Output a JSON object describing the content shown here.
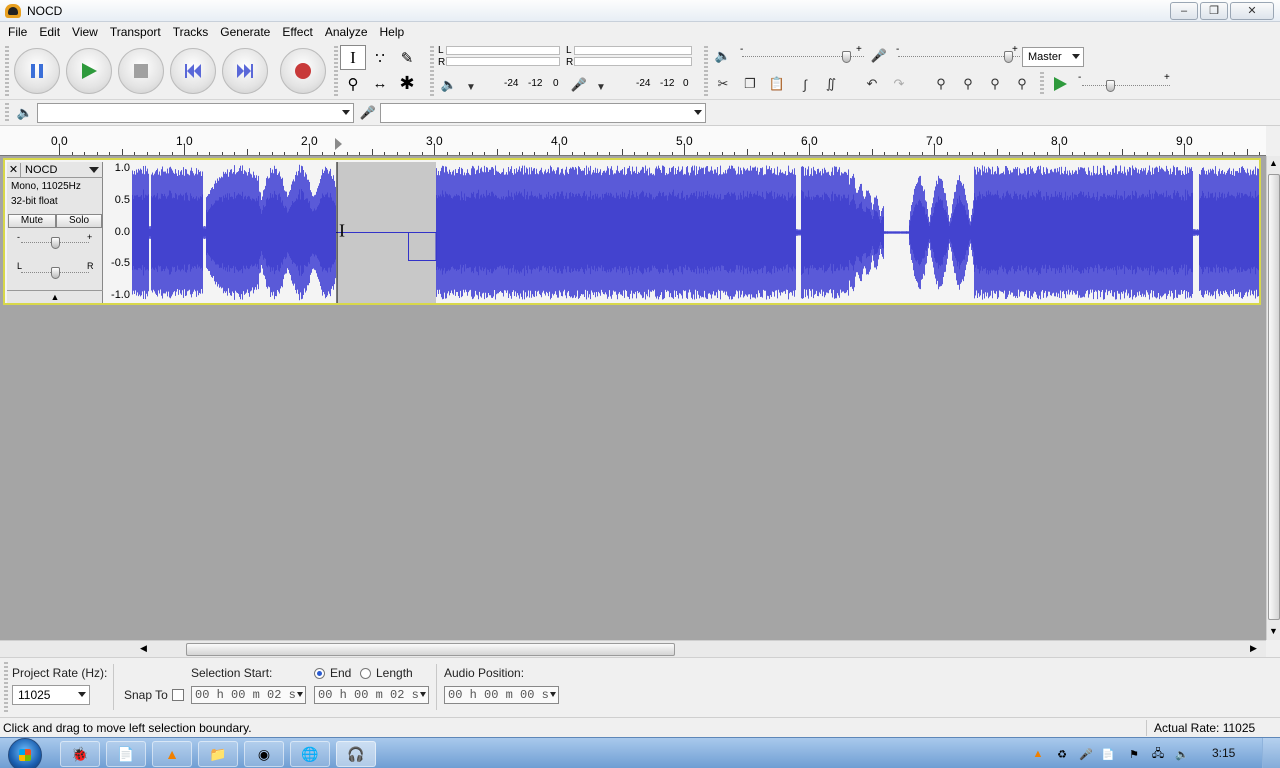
{
  "window": {
    "title": "NOCD",
    "minimize_icon": "minimize-icon",
    "maximize_icon": "maximize-icon",
    "close_icon": "close-icon"
  },
  "menu": [
    "File",
    "Edit",
    "View",
    "Transport",
    "Tracks",
    "Generate",
    "Effect",
    "Analyze",
    "Help"
  ],
  "transport": {
    "buttons": [
      "pause",
      "play",
      "stop",
      "skip-to-start",
      "skip-to-end",
      "record"
    ],
    "colors": {
      "pause": "#3b6fd8",
      "play": "#2e9a3c",
      "stop": "#a0a0a0",
      "skip": "#5a68d8",
      "record": "#c83a3a"
    }
  },
  "meters": {
    "playback_lr": [
      "L",
      "R"
    ],
    "record_lr": [
      "L",
      "R"
    ],
    "scale_play": [
      "-24",
      "-12",
      "0"
    ],
    "scale_rec": [
      "-24",
      "-12",
      "0"
    ]
  },
  "mixer": {
    "output_min": "-",
    "output_max": "+",
    "input_min": "-",
    "input_max": "+",
    "output_level": 0.85,
    "input_level": 0.9,
    "input_source": "Master",
    "speed_min": "-",
    "speed_max": "+",
    "speed_level": 0.32
  },
  "device": {
    "output_device": "",
    "input_device": ""
  },
  "ruler": {
    "labels": [
      "0.0",
      "1.0",
      "2.0",
      "3.0",
      "4.0",
      "5.0",
      "6.0",
      "7.0",
      "8.0",
      "9.0"
    ],
    "x_min": 0.0,
    "x_max": 9.6,
    "cursor_time": 2.2
  },
  "track": {
    "name": "NOCD",
    "info1": "Mono, 11025Hz",
    "info2": "32-bit float",
    "mute": "Mute",
    "solo": "Solo",
    "gain_min": "-",
    "gain_max": "+",
    "pan_left": "L",
    "pan_right": "R",
    "scale": [
      "1.0",
      "0.5",
      "0.0",
      "-0.5",
      "-1.0"
    ],
    "wave_color": "#5a5ad8",
    "wave_dark": "#3232c8",
    "background": "#f4f4f4",
    "selected_border": "#d8d84a",
    "silence_region": [
      2.2,
      3.0
    ]
  },
  "selection": {
    "project_rate_label": "Project Rate (Hz):",
    "project_rate": "11025",
    "snap_label": "Snap To",
    "selection_start_label": "Selection Start:",
    "end_label": "End",
    "length_label": "Length",
    "start_value": "00 h 00 m 02 s",
    "end_value": "00 h 00 m 02 s",
    "audio_position_label": "Audio Position:",
    "audio_position": "00 h 00 m 00 s"
  },
  "status": {
    "message": "Click and drag to move left selection boundary.",
    "actual_rate": "Actual Rate: 11025"
  },
  "taskbar": {
    "clock": "3:15",
    "items": [
      "gaming-app-icon",
      "notepad-icon",
      "vlc-icon",
      "explorer-icon",
      "firefox-icon",
      "network-globe-icon",
      "audacity-icon"
    ],
    "tray": [
      "vlc-tray-icon",
      "update-icon",
      "mic-icon",
      "doc-icon",
      "flag-icon",
      "network-icon",
      "volume-icon"
    ]
  }
}
